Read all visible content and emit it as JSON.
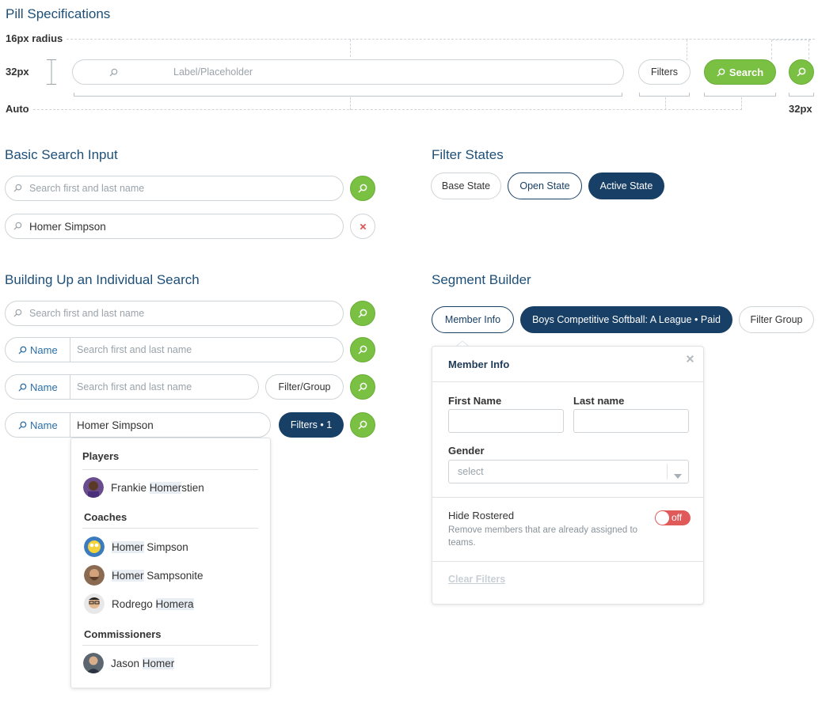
{
  "pill_spec": {
    "title": "Pill Specifications",
    "radius_label": "16px radius",
    "height_label": "32px",
    "auto_label": "Auto",
    "square_label": "32px",
    "placeholder": "Label/Placeholder",
    "filters_label": "Filters",
    "search_label": "Search"
  },
  "basic_search": {
    "title": "Basic Search Input",
    "placeholder": "Search first and last name",
    "value": "Homer Simpson"
  },
  "filter_states": {
    "title": "Filter States",
    "base": "Base State",
    "open": "Open State",
    "active": "Active State"
  },
  "individual_search": {
    "title": "Building Up an Individual Search",
    "placeholder": "Search first and last name",
    "name_label": "Name",
    "filter_group_label": "Filter/Group",
    "value": "Homer Simpson",
    "filters_count_label": "Filters • 1"
  },
  "dropdown": {
    "groups": [
      {
        "title": "Players",
        "people": [
          {
            "pre": "Frankie ",
            "match": "Homer",
            "post": "stien",
            "avatar": "player-avatar"
          }
        ]
      },
      {
        "title": "Coaches",
        "people": [
          {
            "pre": "",
            "match": "Homer",
            "post": " Simpson",
            "avatar": "cartoon-avatar"
          },
          {
            "pre": "",
            "match": "Homer",
            "post": " Sampsonite",
            "avatar": "bearded-avatar"
          },
          {
            "pre": "Rodrego ",
            "match": "Homera",
            "post": "",
            "avatar": "glasses-avatar"
          }
        ]
      },
      {
        "title": "Commissioners",
        "people": [
          {
            "pre": "Jason ",
            "match": "Homer",
            "post": "",
            "avatar": "suit-avatar"
          }
        ]
      }
    ]
  },
  "segment_builder": {
    "title": "Segment Builder",
    "member_info_label": "Member Info",
    "league_label": "Boys Competitive Softball: A League • Paid",
    "filter_group_label": "Filter Group",
    "panel": {
      "title": "Member Info",
      "first_name_label": "First Name",
      "last_name_label": "Last name",
      "gender_label": "Gender",
      "gender_value": "select",
      "hide_rostered_label": "Hide Rostered",
      "hide_rostered_desc": "Remove members that are already assigned to teams.",
      "toggle_label": "off",
      "clear_filters_label": "Clear Filters"
    }
  },
  "colors": {
    "navy": "#183f66",
    "green": "#7ac143",
    "heading_blue": "#1d4f78",
    "danger": "#e05a5a"
  }
}
